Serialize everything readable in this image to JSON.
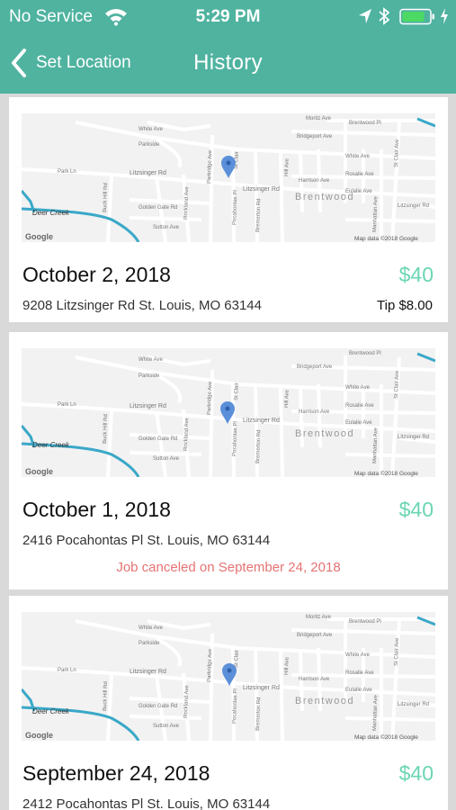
{
  "status_bar": {
    "carrier": "No Service",
    "time": "5:29 PM"
  },
  "nav": {
    "back_label": "Set Location",
    "title": "History"
  },
  "map_labels": {
    "moritz": "Moritz Ave",
    "brentwood_pl": "Brentwood Pl",
    "white": "White Ave",
    "bridgeport": "Bridgeport Ave",
    "parkside": "Parkside",
    "st_clair": "St Clair",
    "st_clair_ave": "St Clair Ave",
    "white_east": "White Ave",
    "litz_west": "Litzsinger Rd",
    "litz_east": "Litzsinger Rd",
    "harrison": "Harrison Ave",
    "rosalie": "Rosalie Ave",
    "eulalie": "Eulalie Ave",
    "park": "Park Ln",
    "buck_hill": "Buck Hill Rd",
    "golden_gate": "Golden Gate Rd",
    "sutton": "Sutton Ave",
    "rockland": "Rockland Ave",
    "parkridge": "Parkridge Ave",
    "pocahontas": "Pocahontas Pl",
    "bremerton": "Bremerton Rd",
    "hill": "Hill Ave",
    "brentwood": "Brentwood",
    "deer_creek": "Deer Creek",
    "google": "Google",
    "attribution": "Map data ©2018 Google",
    "litz_far": "Litzsinger Rd",
    "manhattan": "Manhattan Ave"
  },
  "history": [
    {
      "date": "October 2, 2018",
      "price": "$40",
      "address": "9208 Litzsinger Rd St. Louis, MO 63144",
      "tip": "Tip $8.00",
      "canceled": ""
    },
    {
      "date": "October 1, 2018",
      "price": "$40",
      "address": "2416 Pocahontas Pl St. Louis, MO 63144",
      "tip": "",
      "canceled": "Job canceled on September 24, 2018"
    },
    {
      "date": "September 24, 2018",
      "price": "$40",
      "address": "2412 Pocahontas Pl St. Louis, MO 63144",
      "tip": "",
      "canceled": ""
    }
  ],
  "colors": {
    "header": "#4fb3a0",
    "price": "#6ad6b4",
    "canceled": "#e57373",
    "map_pin": "#5b8fd9",
    "creek": "#3aa8c8"
  }
}
